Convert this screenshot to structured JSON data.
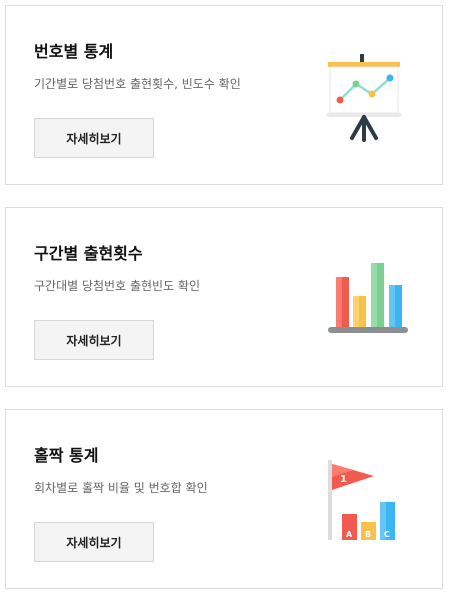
{
  "cards": [
    {
      "title": "번호별 통계",
      "description": "기간별로 당첨번호 출현횟수, 빈도수 확인",
      "button_label": "자세히보기",
      "icon": "presentation-chart-icon"
    },
    {
      "title": "구간별 출현횟수",
      "description": "구간대별 당첨번호 출현빈도 확인",
      "button_label": "자세히보기",
      "icon": "bar-chart-icon"
    },
    {
      "title": "홀짝 통계",
      "description": "회차별로 홀짝 비율 및 번호합 확인",
      "button_label": "자세히보기",
      "icon": "flag-abc-chart-icon",
      "flag_label": "1",
      "bar_labels": [
        "A",
        "B",
        "C"
      ]
    }
  ],
  "colors": {
    "card_border": "#dcdcdc",
    "button_bg": "#f4f4f4",
    "red": "#f05a4f",
    "yellow": "#f9c04c",
    "green": "#7dcf94",
    "blue": "#3db5f2",
    "dark": "#2e3a48"
  }
}
